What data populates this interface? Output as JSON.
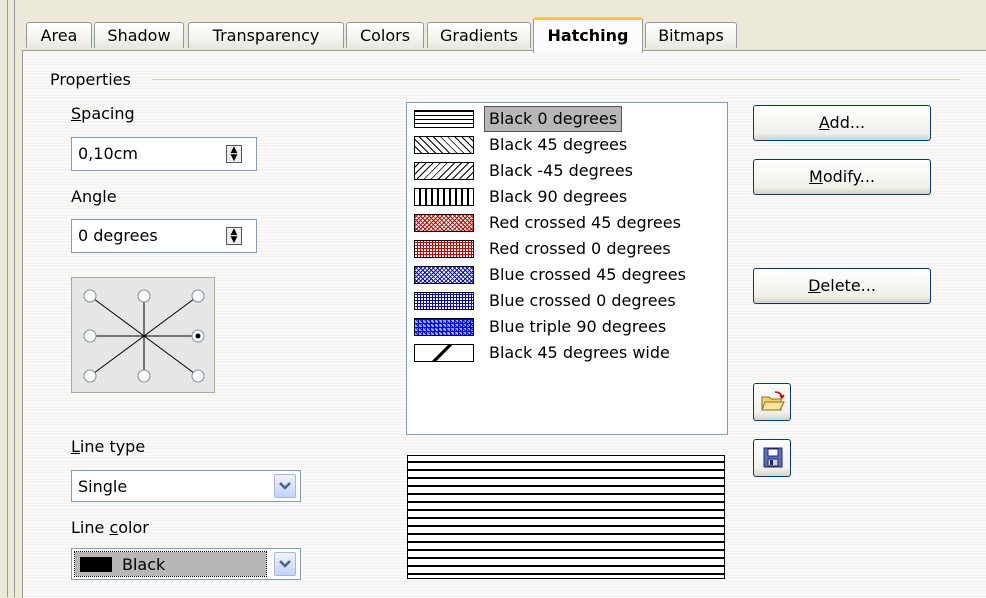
{
  "tabs": [
    {
      "label": "Area"
    },
    {
      "label": "Shadow"
    },
    {
      "label": "Transparency"
    },
    {
      "label": "Colors"
    },
    {
      "label": "Gradients"
    },
    {
      "label": "Hatching",
      "active": true
    },
    {
      "label": "Bitmaps"
    }
  ],
  "properties": {
    "group_label": "Properties",
    "spacing": {
      "label_u": "S",
      "label_rest": "pacing",
      "value": "0,10cm"
    },
    "angle": {
      "label_a": "An",
      "label_u": "g",
      "label_rest": "le",
      "value": "0 degrees",
      "selected_position": "right"
    },
    "line_type": {
      "label_u": "L",
      "label_rest": "ine type",
      "value": "Single"
    },
    "line_color": {
      "label_a": "Line ",
      "label_u": "c",
      "label_rest": "olor",
      "value": "Black",
      "swatch": "#000000"
    }
  },
  "hatch_list": [
    {
      "label": "Black 0 degrees",
      "pattern": "h0",
      "color": "#000000",
      "selected": true
    },
    {
      "label": "Black 45 degrees",
      "pattern": "d45",
      "color": "#000000"
    },
    {
      "label": "Black -45 degrees",
      "pattern": "dm45",
      "color": "#000000"
    },
    {
      "label": "Black 90 degrees",
      "pattern": "v90",
      "color": "#000000"
    },
    {
      "label": "Red crossed 45 degrees",
      "pattern": "x45",
      "color": "#c00000"
    },
    {
      "label": "Red crossed 0 degrees",
      "pattern": "x0",
      "color": "#c00000"
    },
    {
      "label": "Blue crossed 45 degrees",
      "pattern": "x45",
      "color": "#0000c0"
    },
    {
      "label": "Blue crossed 0 degrees",
      "pattern": "x0",
      "color": "#0000c0"
    },
    {
      "label": "Blue triple 90 degrees",
      "pattern": "triple",
      "color": "#0000ff"
    },
    {
      "label": "Black 45 degrees wide",
      "pattern": "wide",
      "color": "#000000"
    }
  ],
  "buttons": {
    "add": {
      "u": "A",
      "rest": "dd..."
    },
    "modify": {
      "u": "M",
      "rest": "odify..."
    },
    "delete": {
      "u": "D",
      "rest": "elete..."
    },
    "load_icon": "open-folder-icon",
    "save_icon": "floppy-disk-icon"
  },
  "colors": {
    "tab_active_accent": "#ffc83c",
    "selection": "#b7b7b7",
    "button_border": "#003c74"
  }
}
